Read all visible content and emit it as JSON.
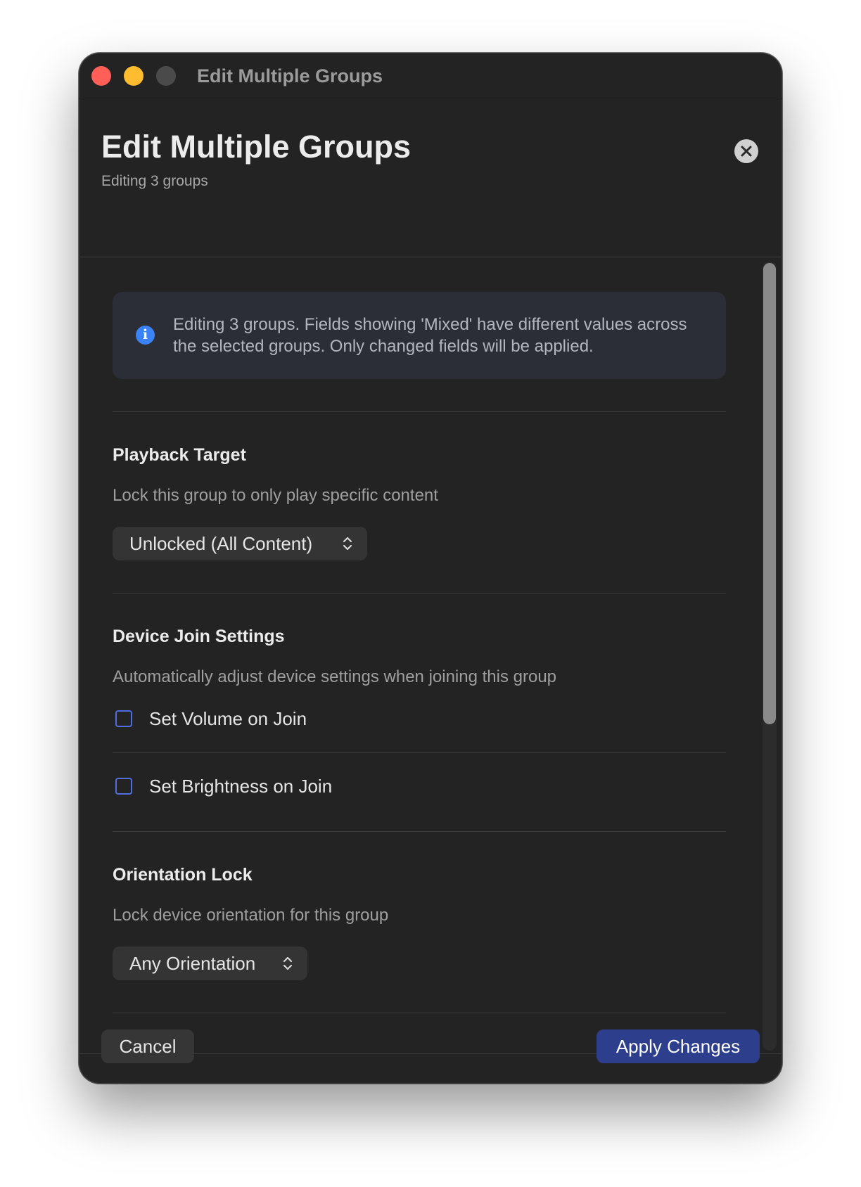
{
  "window": {
    "title": "Edit Multiple Groups"
  },
  "header": {
    "title": "Edit Multiple Groups",
    "subtitle": "Editing 3 groups",
    "close_icon": "close-icon"
  },
  "info": {
    "icon": "info-icon",
    "icon_glyph": "i",
    "text": "Editing 3 groups. Fields showing 'Mixed' have different values across the selected groups. Only changed fields will be applied."
  },
  "playback_target": {
    "title": "Playback Target",
    "description": "Lock this group to only play specific content",
    "selected": "Unlocked (All Content)"
  },
  "device_join": {
    "title": "Device Join Settings",
    "description": "Automatically adjust device settings when joining this group",
    "options": [
      {
        "label": "Set Volume on Join",
        "checked": false
      },
      {
        "label": "Set Brightness on Join",
        "checked": false
      }
    ]
  },
  "orientation_lock": {
    "title": "Orientation Lock",
    "description": "Lock device orientation for this group",
    "selected": "Any Orientation"
  },
  "footer": {
    "cancel_label": "Cancel",
    "apply_label": "Apply Changes"
  },
  "colors": {
    "window_bg": "#232323",
    "accent": "#2d3f8c",
    "checkbox_border": "#4f6fe0",
    "info_icon": "#3b82f6",
    "traffic_close": "#ff5f57",
    "traffic_minimize": "#febc2e",
    "traffic_zoom_inactive": "#4a4a4a"
  }
}
